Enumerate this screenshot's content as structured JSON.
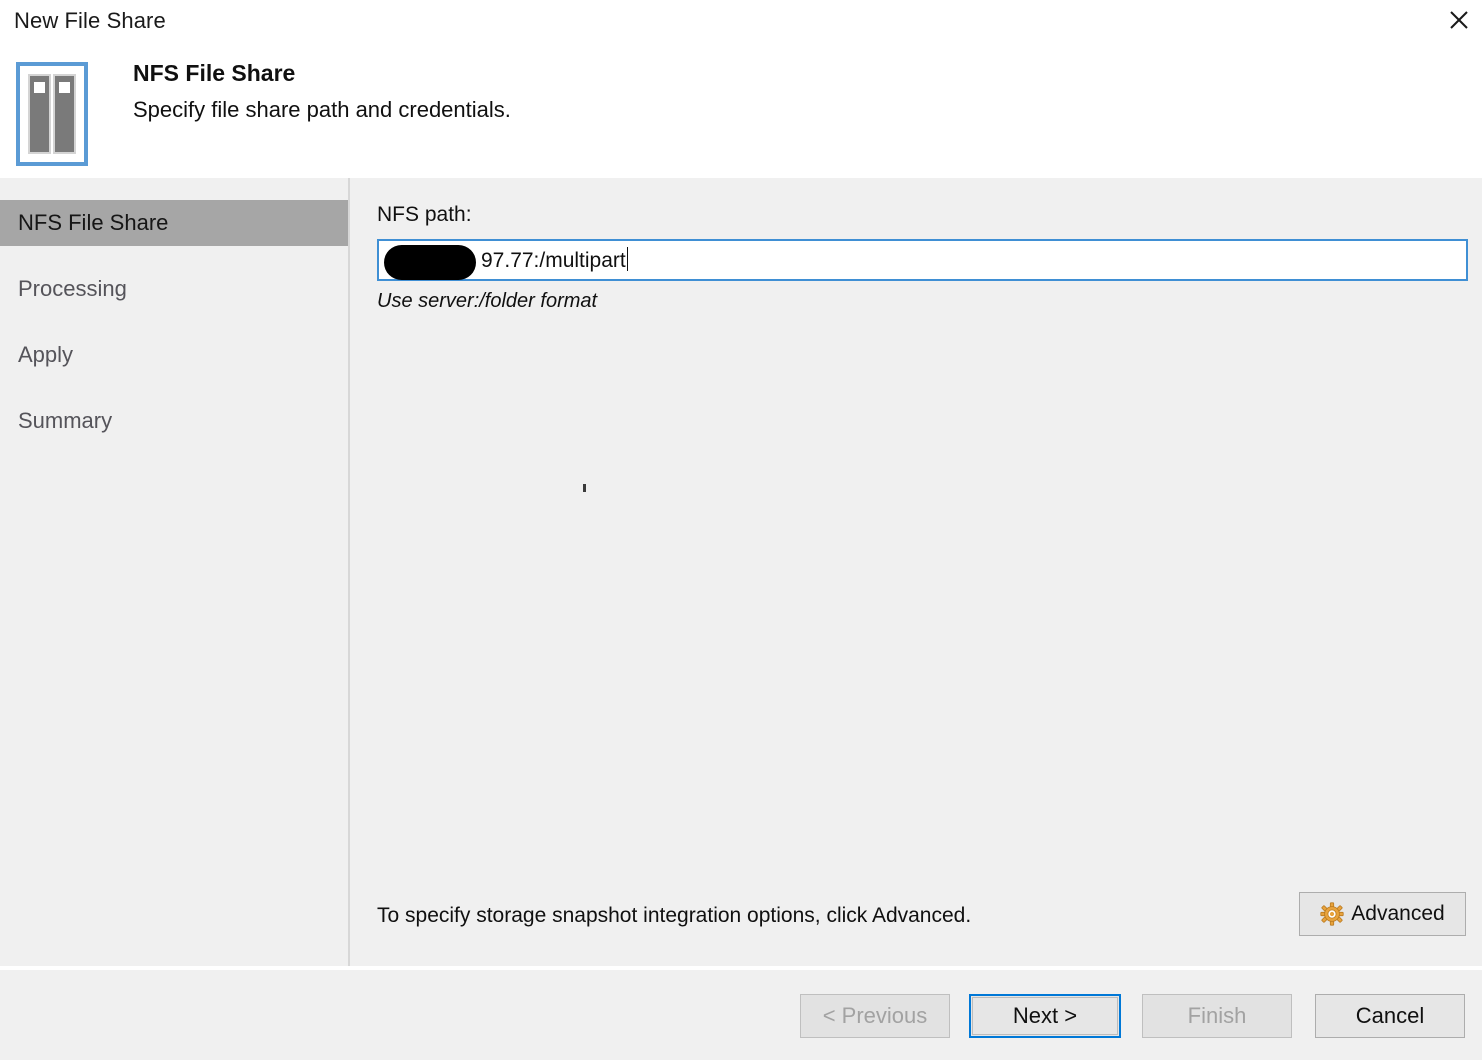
{
  "window": {
    "title": "New File Share",
    "close_icon": "close-icon"
  },
  "header": {
    "icon": "file-share-icon",
    "title": "NFS File Share",
    "subtitle": "Specify file share path and credentials."
  },
  "sidebar": {
    "items": [
      {
        "label": "NFS File Share",
        "selected": true
      },
      {
        "label": "Processing",
        "selected": false
      },
      {
        "label": "Apply",
        "selected": false
      },
      {
        "label": "Summary",
        "selected": false
      }
    ]
  },
  "content": {
    "path_label": "NFS path:",
    "path_value": "97.77:/multipart",
    "path_redacted": true,
    "path_hint": "Use server:/folder format",
    "advanced_note": "To specify storage snapshot integration options, click Advanced.",
    "advanced_button": "Advanced",
    "advanced_icon": "gear-icon"
  },
  "footer": {
    "buttons": [
      {
        "label": "< Previous",
        "state": "disabled"
      },
      {
        "label": "Next >",
        "state": "default"
      },
      {
        "label": "Finish",
        "state": "disabled"
      },
      {
        "label": "Cancel",
        "state": "normal"
      }
    ]
  },
  "colors": {
    "accent": "#0078d7",
    "field_border": "#3f8fd4",
    "selected_row": "#a6a6a6",
    "panel": "#f0f0f0",
    "gear": "#e8a33d"
  }
}
